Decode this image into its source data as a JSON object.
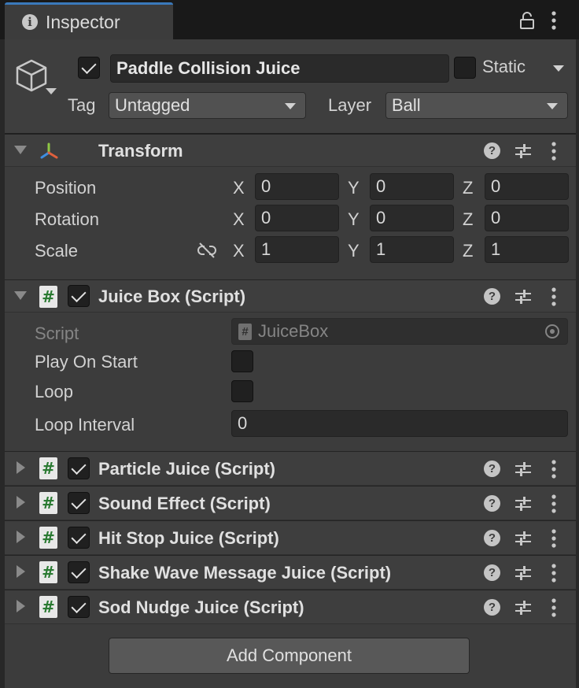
{
  "tab": {
    "title": "Inspector"
  },
  "gameobject": {
    "active": true,
    "name": "Paddle Collision Juice",
    "static_label": "Static",
    "static_checked": false,
    "tag_label": "Tag",
    "tag_value": "Untagged",
    "layer_label": "Layer",
    "layer_value": "Ball"
  },
  "transform": {
    "title": "Transform",
    "rows": [
      {
        "label": "Position",
        "x": "0",
        "y": "0",
        "z": "0"
      },
      {
        "label": "Rotation",
        "x": "0",
        "y": "0",
        "z": "0"
      },
      {
        "label": "Scale",
        "x": "1",
        "y": "1",
        "z": "1"
      }
    ],
    "axis_x": "X",
    "axis_y": "Y",
    "axis_z": "Z"
  },
  "juice_box": {
    "title": "Juice Box (Script)",
    "enabled": true,
    "script_label": "Script",
    "script_value": "JuiceBox",
    "play_on_start_label": "Play On Start",
    "play_on_start": false,
    "loop_label": "Loop",
    "loop": false,
    "loop_interval_label": "Loop Interval",
    "loop_interval": "0"
  },
  "collapsed_components": [
    {
      "title": "Particle Juice (Script)",
      "enabled": true
    },
    {
      "title": "Sound Effect (Script)",
      "enabled": true
    },
    {
      "title": "Hit Stop Juice (Script)",
      "enabled": true
    },
    {
      "title": "Shake Wave Message Juice (Script)",
      "enabled": true
    },
    {
      "title": "Sod Nudge Juice (Script)",
      "enabled": true
    }
  ],
  "add_component_label": "Add Component",
  "icons": {
    "info": "i",
    "script": "#",
    "help": "?"
  }
}
